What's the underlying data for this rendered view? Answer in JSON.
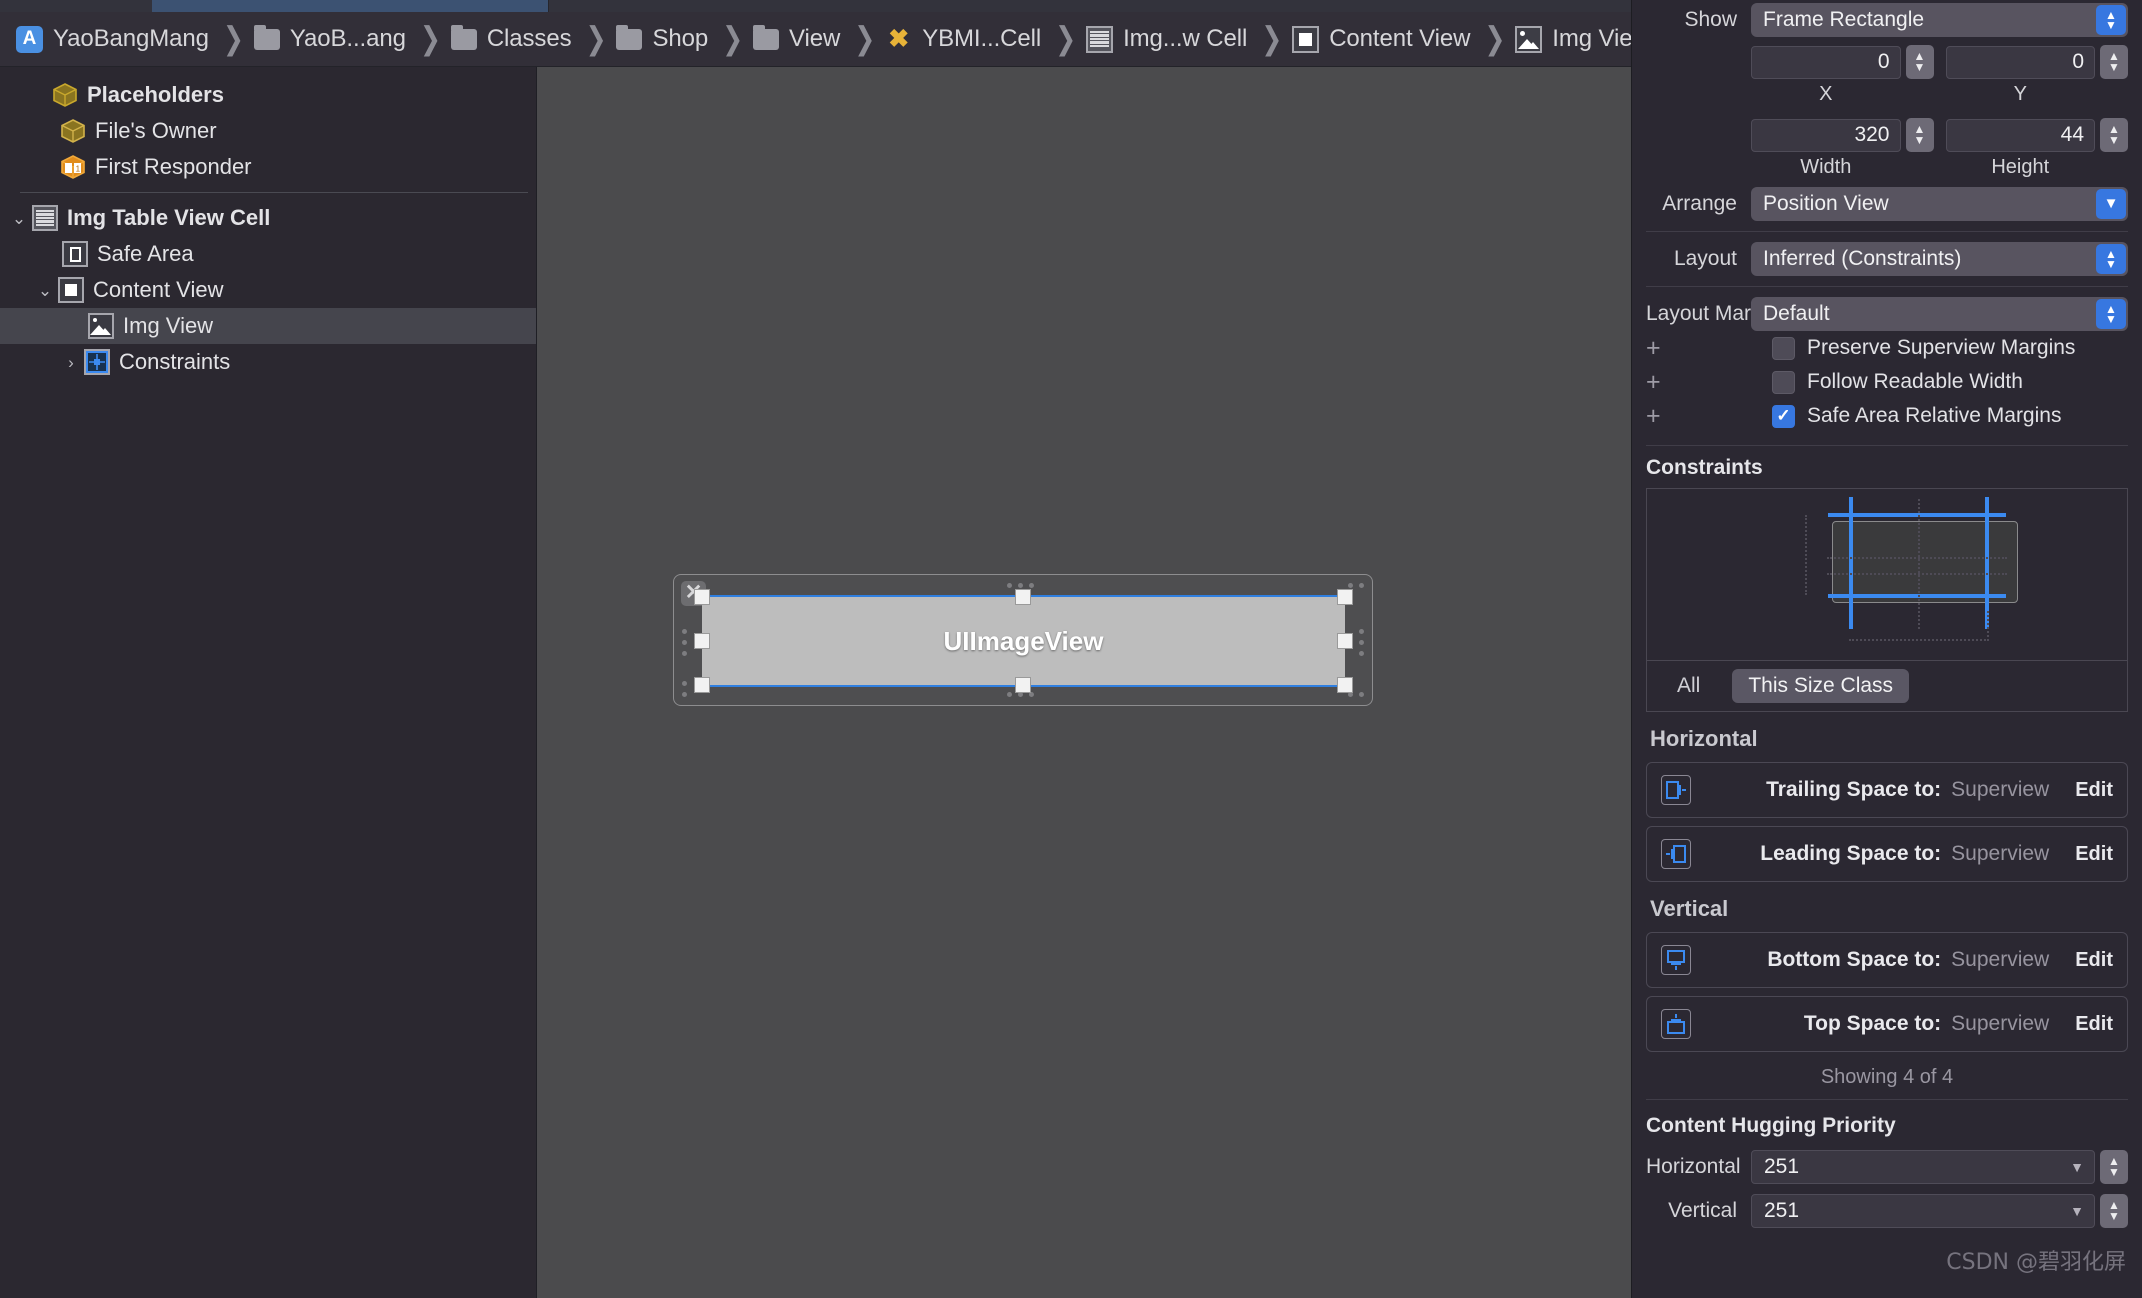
{
  "window": {
    "app": "Xcode",
    "tab_bar": {
      "active_tab_present": true
    }
  },
  "jump_bar": {
    "crumbs": [
      {
        "label": "YaoBangMang",
        "icon": "xcode-project-icon"
      },
      {
        "label": "YaoB...ang",
        "icon": "folder-icon"
      },
      {
        "label": "Classes",
        "icon": "folder-icon"
      },
      {
        "label": "Shop",
        "icon": "folder-icon"
      },
      {
        "label": "View",
        "icon": "folder-icon"
      },
      {
        "label": "YBMI...Cell",
        "icon": "swift-file-icon"
      },
      {
        "label": "Img...w Cell",
        "icon": "table-view-cell-icon"
      },
      {
        "label": "Content View",
        "icon": "white-view-icon"
      },
      {
        "label": "Img View",
        "icon": "image-view-icon"
      }
    ],
    "nav": {
      "back": "‹",
      "forward": "›",
      "warning_badge": "!"
    }
  },
  "outline": {
    "rows": [
      {
        "label": "Placeholders",
        "icon": "placeholder-cube-icon",
        "indent": 0,
        "bold": true,
        "disclosure": "",
        "selected": false
      },
      {
        "label": "File's Owner",
        "icon": "files-owner-cube-icon",
        "indent": 1,
        "bold": false,
        "disclosure": "",
        "selected": false
      },
      {
        "label": "First Responder",
        "icon": "first-responder-cube-icon",
        "indent": 1,
        "bold": false,
        "disclosure": "",
        "selected": false
      },
      {
        "label": "Img Table View Cell",
        "icon": "table-view-cell-icon",
        "indent": 0,
        "bold": true,
        "disclosure": "⌄",
        "selected": false
      },
      {
        "label": "Safe Area",
        "icon": "safe-area-icon",
        "indent": 1,
        "bold": false,
        "disclosure": "",
        "selected": false
      },
      {
        "label": "Content View",
        "icon": "white-view-icon",
        "indent": 1,
        "bold": false,
        "disclosure": "⌄",
        "selected": false
      },
      {
        "label": "Img View",
        "icon": "image-view-icon",
        "indent": 2,
        "bold": false,
        "disclosure": "",
        "selected": true
      },
      {
        "label": "Constraints",
        "icon": "constraints-icon",
        "indent": 1,
        "bold": false,
        "disclosure": "›",
        "selected": false
      }
    ]
  },
  "canvas": {
    "selected_view_label": "UIImageView",
    "close_glyph": "✕"
  },
  "inspector": {
    "show": {
      "label": "Show",
      "value": "Frame Rectangle"
    },
    "frame": {
      "x": {
        "value": "0",
        "caption": "X"
      },
      "y": {
        "value": "0",
        "caption": "Y"
      },
      "width": {
        "value": "320",
        "caption": "Width"
      },
      "height": {
        "value": "44",
        "caption": "Height"
      }
    },
    "arrange": {
      "label": "Arrange",
      "value": "Position View"
    },
    "layout": {
      "label": "Layout",
      "value": "Inferred (Constraints)"
    },
    "layout_margins": {
      "label": "Layout Margins",
      "value": "Default"
    },
    "checkboxes": [
      {
        "label": "Preserve Superview Margins",
        "checked": false
      },
      {
        "label": "Follow Readable Width",
        "checked": false
      },
      {
        "label": "Safe Area Relative Margins",
        "checked": true
      }
    ],
    "constraints": {
      "title": "Constraints",
      "size_class_tabs": [
        {
          "label": "All",
          "active": false
        },
        {
          "label": "This Size Class",
          "active": true
        }
      ],
      "horizontal_title": "Horizontal",
      "vertical_title": "Vertical",
      "horizontal_items": [
        {
          "name": "Trailing Space to:",
          "target": "Superview",
          "edit": "Edit",
          "icon": "trailing-space-icon"
        },
        {
          "name": "Leading Space to:",
          "target": "Superview",
          "edit": "Edit",
          "icon": "leading-space-icon"
        }
      ],
      "vertical_items": [
        {
          "name": "Bottom Space to:",
          "target": "Superview",
          "edit": "Edit",
          "icon": "bottom-space-icon"
        },
        {
          "name": "Top Space to:",
          "target": "Superview",
          "edit": "Edit",
          "icon": "top-space-icon"
        }
      ],
      "showing": "Showing 4 of 4"
    },
    "content_hugging": {
      "title": "Content Hugging Priority",
      "horizontal": {
        "label": "Horizontal",
        "value": "251"
      },
      "vertical": {
        "label": "Vertical",
        "value": "251"
      }
    }
  },
  "watermark": "CSDN @碧羽化屏",
  "colors": {
    "accent_blue": "#3777e0",
    "selection_blue": "#2f7fe0",
    "warning_yellow": "#f0b429",
    "panel_bg": "#2b2832",
    "canvas_bg": "#4b4b4d"
  }
}
